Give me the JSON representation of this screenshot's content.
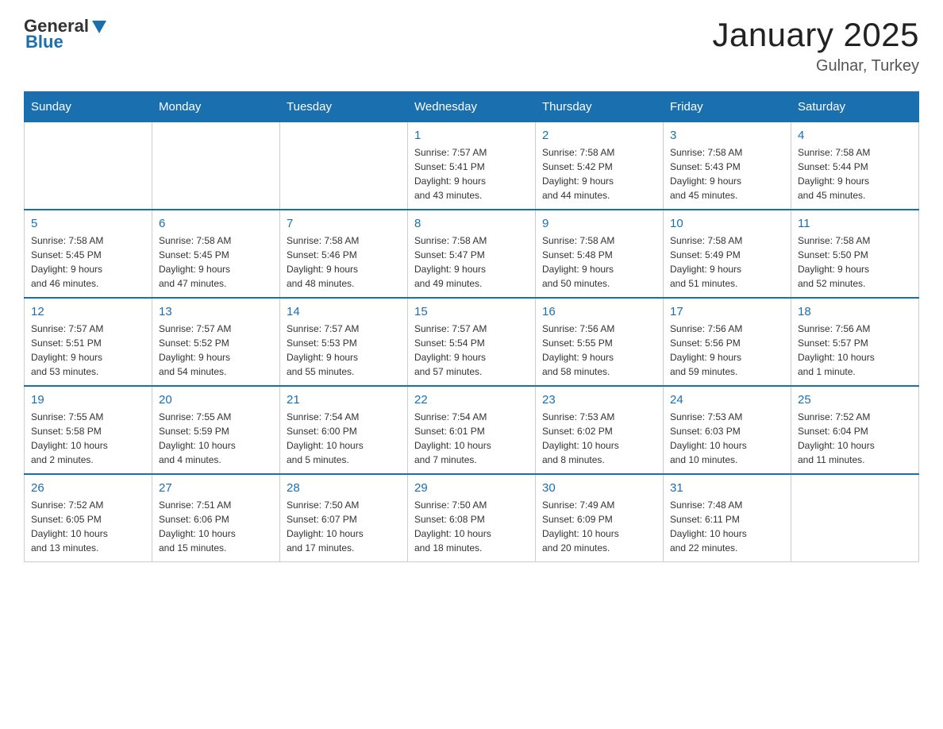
{
  "header": {
    "logo_general": "General",
    "logo_blue": "Blue",
    "title": "January 2025",
    "subtitle": "Gulnar, Turkey"
  },
  "days_of_week": [
    "Sunday",
    "Monday",
    "Tuesday",
    "Wednesday",
    "Thursday",
    "Friday",
    "Saturday"
  ],
  "weeks": [
    [
      {
        "day": "",
        "info": ""
      },
      {
        "day": "",
        "info": ""
      },
      {
        "day": "",
        "info": ""
      },
      {
        "day": "1",
        "info": "Sunrise: 7:57 AM\nSunset: 5:41 PM\nDaylight: 9 hours\nand 43 minutes."
      },
      {
        "day": "2",
        "info": "Sunrise: 7:58 AM\nSunset: 5:42 PM\nDaylight: 9 hours\nand 44 minutes."
      },
      {
        "day": "3",
        "info": "Sunrise: 7:58 AM\nSunset: 5:43 PM\nDaylight: 9 hours\nand 45 minutes."
      },
      {
        "day": "4",
        "info": "Sunrise: 7:58 AM\nSunset: 5:44 PM\nDaylight: 9 hours\nand 45 minutes."
      }
    ],
    [
      {
        "day": "5",
        "info": "Sunrise: 7:58 AM\nSunset: 5:45 PM\nDaylight: 9 hours\nand 46 minutes."
      },
      {
        "day": "6",
        "info": "Sunrise: 7:58 AM\nSunset: 5:45 PM\nDaylight: 9 hours\nand 47 minutes."
      },
      {
        "day": "7",
        "info": "Sunrise: 7:58 AM\nSunset: 5:46 PM\nDaylight: 9 hours\nand 48 minutes."
      },
      {
        "day": "8",
        "info": "Sunrise: 7:58 AM\nSunset: 5:47 PM\nDaylight: 9 hours\nand 49 minutes."
      },
      {
        "day": "9",
        "info": "Sunrise: 7:58 AM\nSunset: 5:48 PM\nDaylight: 9 hours\nand 50 minutes."
      },
      {
        "day": "10",
        "info": "Sunrise: 7:58 AM\nSunset: 5:49 PM\nDaylight: 9 hours\nand 51 minutes."
      },
      {
        "day": "11",
        "info": "Sunrise: 7:58 AM\nSunset: 5:50 PM\nDaylight: 9 hours\nand 52 minutes."
      }
    ],
    [
      {
        "day": "12",
        "info": "Sunrise: 7:57 AM\nSunset: 5:51 PM\nDaylight: 9 hours\nand 53 minutes."
      },
      {
        "day": "13",
        "info": "Sunrise: 7:57 AM\nSunset: 5:52 PM\nDaylight: 9 hours\nand 54 minutes."
      },
      {
        "day": "14",
        "info": "Sunrise: 7:57 AM\nSunset: 5:53 PM\nDaylight: 9 hours\nand 55 minutes."
      },
      {
        "day": "15",
        "info": "Sunrise: 7:57 AM\nSunset: 5:54 PM\nDaylight: 9 hours\nand 57 minutes."
      },
      {
        "day": "16",
        "info": "Sunrise: 7:56 AM\nSunset: 5:55 PM\nDaylight: 9 hours\nand 58 minutes."
      },
      {
        "day": "17",
        "info": "Sunrise: 7:56 AM\nSunset: 5:56 PM\nDaylight: 9 hours\nand 59 minutes."
      },
      {
        "day": "18",
        "info": "Sunrise: 7:56 AM\nSunset: 5:57 PM\nDaylight: 10 hours\nand 1 minute."
      }
    ],
    [
      {
        "day": "19",
        "info": "Sunrise: 7:55 AM\nSunset: 5:58 PM\nDaylight: 10 hours\nand 2 minutes."
      },
      {
        "day": "20",
        "info": "Sunrise: 7:55 AM\nSunset: 5:59 PM\nDaylight: 10 hours\nand 4 minutes."
      },
      {
        "day": "21",
        "info": "Sunrise: 7:54 AM\nSunset: 6:00 PM\nDaylight: 10 hours\nand 5 minutes."
      },
      {
        "day": "22",
        "info": "Sunrise: 7:54 AM\nSunset: 6:01 PM\nDaylight: 10 hours\nand 7 minutes."
      },
      {
        "day": "23",
        "info": "Sunrise: 7:53 AM\nSunset: 6:02 PM\nDaylight: 10 hours\nand 8 minutes."
      },
      {
        "day": "24",
        "info": "Sunrise: 7:53 AM\nSunset: 6:03 PM\nDaylight: 10 hours\nand 10 minutes."
      },
      {
        "day": "25",
        "info": "Sunrise: 7:52 AM\nSunset: 6:04 PM\nDaylight: 10 hours\nand 11 minutes."
      }
    ],
    [
      {
        "day": "26",
        "info": "Sunrise: 7:52 AM\nSunset: 6:05 PM\nDaylight: 10 hours\nand 13 minutes."
      },
      {
        "day": "27",
        "info": "Sunrise: 7:51 AM\nSunset: 6:06 PM\nDaylight: 10 hours\nand 15 minutes."
      },
      {
        "day": "28",
        "info": "Sunrise: 7:50 AM\nSunset: 6:07 PM\nDaylight: 10 hours\nand 17 minutes."
      },
      {
        "day": "29",
        "info": "Sunrise: 7:50 AM\nSunset: 6:08 PM\nDaylight: 10 hours\nand 18 minutes."
      },
      {
        "day": "30",
        "info": "Sunrise: 7:49 AM\nSunset: 6:09 PM\nDaylight: 10 hours\nand 20 minutes."
      },
      {
        "day": "31",
        "info": "Sunrise: 7:48 AM\nSunset: 6:11 PM\nDaylight: 10 hours\nand 22 minutes."
      },
      {
        "day": "",
        "info": ""
      }
    ]
  ]
}
